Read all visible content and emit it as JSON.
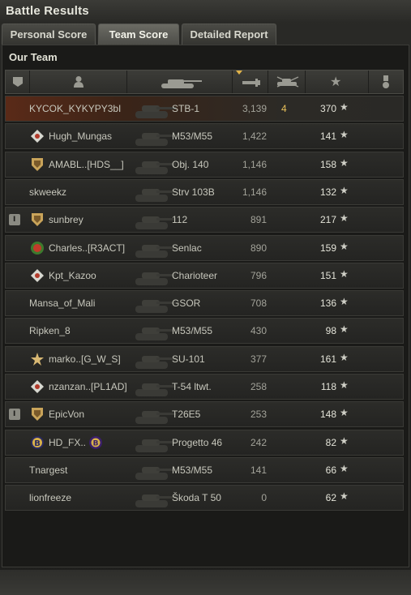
{
  "window": {
    "title": "Battle Results"
  },
  "tabs": [
    {
      "label": "Personal Score"
    },
    {
      "label": "Team Score"
    },
    {
      "label": "Detailed Report"
    }
  ],
  "team": {
    "label": "Our Team"
  },
  "header_icons": [
    "platoon-icon",
    "player-icon",
    "tank-icon",
    "damage-icon",
    "kills-icon",
    "experience-star-icon",
    "medal-icon"
  ],
  "colors": {
    "player_row": "#5a2a18",
    "kills": "#e9c15a",
    "sort_arrow": "#e0b34a"
  },
  "rows": [
    {
      "name": "KYCOK_KYKYPY3bI",
      "tank": "STB-1",
      "damage": "3,139",
      "kills": "4",
      "xp": "370",
      "platoon": "",
      "clan": "",
      "player": true
    },
    {
      "name": "Hugh_Mungas",
      "tank": "M53/M55",
      "damage": "1,422",
      "kills": "",
      "xp": "141",
      "platoon": "",
      "clan": "diamond"
    },
    {
      "name": "AMABL..[HDS__]",
      "tank": "Obj. 140",
      "damage": "1,146",
      "kills": "",
      "xp": "158",
      "platoon": "",
      "clan": "shield"
    },
    {
      "name": "skweekz",
      "tank": "Strv 103B",
      "damage": "1,146",
      "kills": "",
      "xp": "132",
      "platoon": "",
      "clan": ""
    },
    {
      "name": "sunbrey",
      "tank": "112",
      "damage": "891",
      "kills": "",
      "xp": "217",
      "platoon": "I",
      "clan": "shield"
    },
    {
      "name": "Charles..[R3ACT]",
      "tank": "Senlac",
      "damage": "890",
      "kills": "",
      "xp": "159",
      "platoon": "",
      "clan": "badge"
    },
    {
      "name": "Kpt_Kazoo",
      "tank": "Charioteer",
      "damage": "796",
      "kills": "",
      "xp": "151",
      "platoon": "",
      "clan": "diamond"
    },
    {
      "name": "Mansa_of_Mali",
      "tank": "GSOR",
      "damage": "708",
      "kills": "",
      "xp": "136",
      "platoon": "",
      "clan": ""
    },
    {
      "name": "Ripken_8",
      "tank": "M53/M55",
      "damage": "430",
      "kills": "",
      "xp": "98",
      "platoon": "",
      "clan": ""
    },
    {
      "name": "marko..[G_W_S]",
      "tank": "SU-101",
      "damage": "377",
      "kills": "",
      "xp": "161",
      "platoon": "",
      "clan": "star"
    },
    {
      "name": "nzanzan..[PL1AD]",
      "tank": "T-54 ltwt.",
      "damage": "258",
      "kills": "",
      "xp": "118",
      "platoon": "",
      "clan": "diamond"
    },
    {
      "name": "EpicVon",
      "tank": "T26E5",
      "damage": "253",
      "kills": "",
      "xp": "148",
      "platoon": "I",
      "clan": "shield"
    },
    {
      "name": "HD_FX..",
      "tank": "Progetto 46",
      "damage": "242",
      "kills": "",
      "xp": "82",
      "platoon": "",
      "clan": "b-badge"
    },
    {
      "name": "Tnargest",
      "tank": "M53/M55",
      "damage": "141",
      "kills": "",
      "xp": "66",
      "platoon": "",
      "clan": ""
    },
    {
      "name": "lionfreeze",
      "tank": "Škoda T 50",
      "damage": "0",
      "kills": "",
      "xp": "62",
      "platoon": "",
      "clan": ""
    }
  ]
}
